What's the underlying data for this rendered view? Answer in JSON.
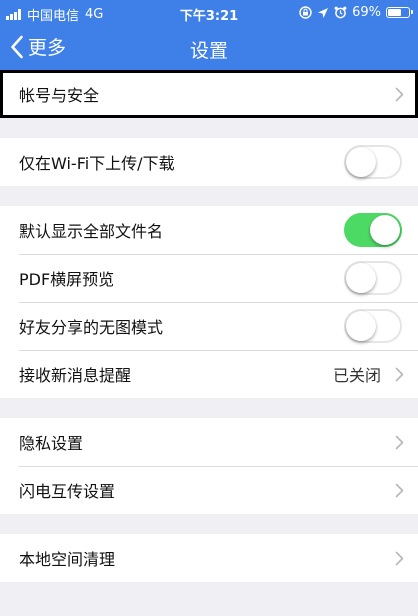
{
  "status_bar": {
    "carrier": "中国电信",
    "network": "4G",
    "time": "下午3:21",
    "battery_percent": "69%",
    "battery_level": 0.69
  },
  "nav": {
    "back_label": "更多",
    "title": "设置"
  },
  "groups": [
    {
      "rows": [
        {
          "label": "帐号与安全",
          "kind": "link",
          "selected": true
        }
      ]
    },
    {
      "rows": [
        {
          "label": "仅在Wi-Fi下上传/下载",
          "kind": "toggle",
          "on": false
        }
      ]
    },
    {
      "rows": [
        {
          "label": "默认显示全部文件名",
          "kind": "toggle",
          "on": true
        },
        {
          "label": "PDF横屏预览",
          "kind": "toggle",
          "on": false
        },
        {
          "label": "好友分享的无图模式",
          "kind": "toggle",
          "on": false
        },
        {
          "label": "接收新消息提醒",
          "kind": "link",
          "value": "已关闭"
        }
      ]
    },
    {
      "rows": [
        {
          "label": "隐私设置",
          "kind": "link"
        },
        {
          "label": "闪电互传设置",
          "kind": "link"
        }
      ]
    },
    {
      "rows": [
        {
          "label": "本地空间清理",
          "kind": "link"
        }
      ]
    }
  ],
  "colors": {
    "nav_background": "#3f7fe8",
    "toggle_on": "#4cd964",
    "page_background": "#efeff4"
  },
  "icons": {
    "back": "chevron-left-icon",
    "row_link": "chevron-right-icon"
  }
}
